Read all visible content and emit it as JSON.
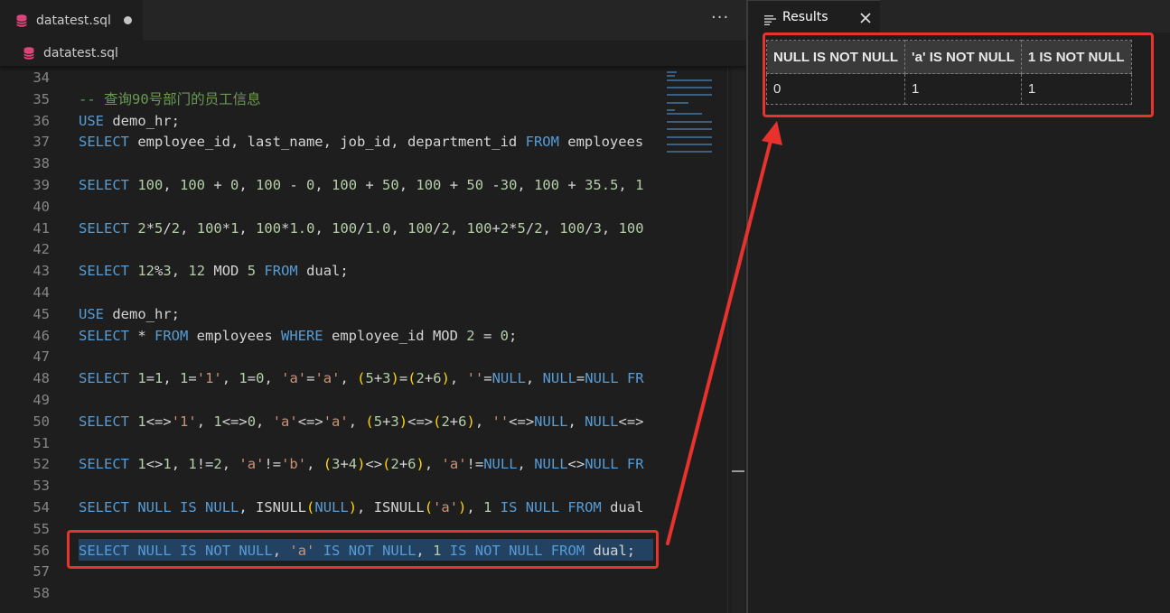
{
  "editor": {
    "tab_label": "datatest.sql",
    "breadcrumb_label": "datatest.sql",
    "more_actions_label": "···"
  },
  "code_lines": [
    {
      "num": "34",
      "tokens": []
    },
    {
      "num": "35",
      "tokens": [
        {
          "t": "-- 查询90号部门的员工信息",
          "c": "com"
        }
      ]
    },
    {
      "num": "36",
      "tokens": [
        {
          "t": "USE",
          "c": "kw"
        },
        {
          "t": " demo_hr;",
          "c": "id"
        }
      ]
    },
    {
      "num": "37",
      "tokens": [
        {
          "t": "SELECT",
          "c": "kw"
        },
        {
          "t": " employee_id, last_name, job_id, department_id ",
          "c": "id"
        },
        {
          "t": "FROM",
          "c": "kw"
        },
        {
          "t": " employees",
          "c": "id"
        }
      ]
    },
    {
      "num": "38",
      "tokens": []
    },
    {
      "num": "39",
      "tokens": [
        {
          "t": "SELECT",
          "c": "kw"
        },
        {
          "t": " ",
          "c": "id"
        },
        {
          "t": "100",
          "c": "num"
        },
        {
          "t": ", ",
          "c": "pun"
        },
        {
          "t": "100",
          "c": "num"
        },
        {
          "t": " + ",
          "c": "pun"
        },
        {
          "t": "0",
          "c": "num"
        },
        {
          "t": ", ",
          "c": "pun"
        },
        {
          "t": "100",
          "c": "num"
        },
        {
          "t": " - ",
          "c": "pun"
        },
        {
          "t": "0",
          "c": "num"
        },
        {
          "t": ", ",
          "c": "pun"
        },
        {
          "t": "100",
          "c": "num"
        },
        {
          "t": " + ",
          "c": "pun"
        },
        {
          "t": "50",
          "c": "num"
        },
        {
          "t": ", ",
          "c": "pun"
        },
        {
          "t": "100",
          "c": "num"
        },
        {
          "t": " + ",
          "c": "pun"
        },
        {
          "t": "50",
          "c": "num"
        },
        {
          "t": " -",
          "c": "pun"
        },
        {
          "t": "30",
          "c": "num"
        },
        {
          "t": ", ",
          "c": "pun"
        },
        {
          "t": "100",
          "c": "num"
        },
        {
          "t": " + ",
          "c": "pun"
        },
        {
          "t": "35.5",
          "c": "num"
        },
        {
          "t": ", ",
          "c": "pun"
        },
        {
          "t": "1",
          "c": "num"
        }
      ]
    },
    {
      "num": "40",
      "tokens": []
    },
    {
      "num": "41",
      "tokens": [
        {
          "t": "SELECT",
          "c": "kw"
        },
        {
          "t": " ",
          "c": "id"
        },
        {
          "t": "2",
          "c": "num"
        },
        {
          "t": "*",
          "c": "pun"
        },
        {
          "t": "5",
          "c": "num"
        },
        {
          "t": "/",
          "c": "pun"
        },
        {
          "t": "2",
          "c": "num"
        },
        {
          "t": ", ",
          "c": "pun"
        },
        {
          "t": "100",
          "c": "num"
        },
        {
          "t": "*",
          "c": "pun"
        },
        {
          "t": "1",
          "c": "num"
        },
        {
          "t": ", ",
          "c": "pun"
        },
        {
          "t": "100",
          "c": "num"
        },
        {
          "t": "*",
          "c": "pun"
        },
        {
          "t": "1.0",
          "c": "num"
        },
        {
          "t": ", ",
          "c": "pun"
        },
        {
          "t": "100",
          "c": "num"
        },
        {
          "t": "/",
          "c": "pun"
        },
        {
          "t": "1.0",
          "c": "num"
        },
        {
          "t": ", ",
          "c": "pun"
        },
        {
          "t": "100",
          "c": "num"
        },
        {
          "t": "/",
          "c": "pun"
        },
        {
          "t": "2",
          "c": "num"
        },
        {
          "t": ", ",
          "c": "pun"
        },
        {
          "t": "100",
          "c": "num"
        },
        {
          "t": "+",
          "c": "pun"
        },
        {
          "t": "2",
          "c": "num"
        },
        {
          "t": "*",
          "c": "pun"
        },
        {
          "t": "5",
          "c": "num"
        },
        {
          "t": "/",
          "c": "pun"
        },
        {
          "t": "2",
          "c": "num"
        },
        {
          "t": ", ",
          "c": "pun"
        },
        {
          "t": "100",
          "c": "num"
        },
        {
          "t": "/",
          "c": "pun"
        },
        {
          "t": "3",
          "c": "num"
        },
        {
          "t": ", ",
          "c": "pun"
        },
        {
          "t": "100",
          "c": "num"
        }
      ]
    },
    {
      "num": "42",
      "tokens": []
    },
    {
      "num": "43",
      "tokens": [
        {
          "t": "SELECT",
          "c": "kw"
        },
        {
          "t": " ",
          "c": "id"
        },
        {
          "t": "12",
          "c": "num"
        },
        {
          "t": "%",
          "c": "pun"
        },
        {
          "t": "3",
          "c": "num"
        },
        {
          "t": ", ",
          "c": "pun"
        },
        {
          "t": "12",
          "c": "num"
        },
        {
          "t": " MOD ",
          "c": "id"
        },
        {
          "t": "5",
          "c": "num"
        },
        {
          "t": " ",
          "c": "id"
        },
        {
          "t": "FROM",
          "c": "kw"
        },
        {
          "t": " dual;",
          "c": "id"
        }
      ]
    },
    {
      "num": "44",
      "tokens": []
    },
    {
      "num": "45",
      "tokens": [
        {
          "t": "USE",
          "c": "kw"
        },
        {
          "t": " demo_hr;",
          "c": "id"
        }
      ]
    },
    {
      "num": "46",
      "tokens": [
        {
          "t": "SELECT",
          "c": "kw"
        },
        {
          "t": " * ",
          "c": "id"
        },
        {
          "t": "FROM",
          "c": "kw"
        },
        {
          "t": " employees ",
          "c": "id"
        },
        {
          "t": "WHERE",
          "c": "kw"
        },
        {
          "t": " employee_id MOD ",
          "c": "id"
        },
        {
          "t": "2",
          "c": "num"
        },
        {
          "t": " = ",
          "c": "pun"
        },
        {
          "t": "0",
          "c": "num"
        },
        {
          "t": ";",
          "c": "pun"
        }
      ]
    },
    {
      "num": "47",
      "tokens": []
    },
    {
      "num": "48",
      "tokens": [
        {
          "t": "SELECT",
          "c": "kw"
        },
        {
          "t": " ",
          "c": "id"
        },
        {
          "t": "1",
          "c": "num"
        },
        {
          "t": "=",
          "c": "pun"
        },
        {
          "t": "1",
          "c": "num"
        },
        {
          "t": ", ",
          "c": "pun"
        },
        {
          "t": "1",
          "c": "num"
        },
        {
          "t": "=",
          "c": "pun"
        },
        {
          "t": "'1'",
          "c": "str"
        },
        {
          "t": ", ",
          "c": "pun"
        },
        {
          "t": "1",
          "c": "num"
        },
        {
          "t": "=",
          "c": "pun"
        },
        {
          "t": "0",
          "c": "num"
        },
        {
          "t": ", ",
          "c": "pun"
        },
        {
          "t": "'a'",
          "c": "str"
        },
        {
          "t": "=",
          "c": "pun"
        },
        {
          "t": "'a'",
          "c": "str"
        },
        {
          "t": ", ",
          "c": "pun"
        },
        {
          "t": "(",
          "c": "par"
        },
        {
          "t": "5",
          "c": "num"
        },
        {
          "t": "+",
          "c": "pun"
        },
        {
          "t": "3",
          "c": "num"
        },
        {
          "t": ")",
          "c": "par"
        },
        {
          "t": "=",
          "c": "pun"
        },
        {
          "t": "(",
          "c": "par"
        },
        {
          "t": "2",
          "c": "num"
        },
        {
          "t": "+",
          "c": "pun"
        },
        {
          "t": "6",
          "c": "num"
        },
        {
          "t": ")",
          "c": "par"
        },
        {
          "t": ", ",
          "c": "pun"
        },
        {
          "t": "''",
          "c": "str"
        },
        {
          "t": "=",
          "c": "pun"
        },
        {
          "t": "NULL",
          "c": "kw"
        },
        {
          "t": ", ",
          "c": "pun"
        },
        {
          "t": "NULL",
          "c": "kw"
        },
        {
          "t": "=",
          "c": "pun"
        },
        {
          "t": "NULL",
          "c": "kw"
        },
        {
          "t": " ",
          "c": "id"
        },
        {
          "t": "FR",
          "c": "kw"
        }
      ]
    },
    {
      "num": "49",
      "tokens": []
    },
    {
      "num": "50",
      "tokens": [
        {
          "t": "SELECT",
          "c": "kw"
        },
        {
          "t": " ",
          "c": "id"
        },
        {
          "t": "1",
          "c": "num"
        },
        {
          "t": "<=>",
          "c": "pun"
        },
        {
          "t": "'1'",
          "c": "str"
        },
        {
          "t": ", ",
          "c": "pun"
        },
        {
          "t": "1",
          "c": "num"
        },
        {
          "t": "<=>",
          "c": "pun"
        },
        {
          "t": "0",
          "c": "num"
        },
        {
          "t": ", ",
          "c": "pun"
        },
        {
          "t": "'a'",
          "c": "str"
        },
        {
          "t": "<=>",
          "c": "pun"
        },
        {
          "t": "'a'",
          "c": "str"
        },
        {
          "t": ", ",
          "c": "pun"
        },
        {
          "t": "(",
          "c": "par"
        },
        {
          "t": "5",
          "c": "num"
        },
        {
          "t": "+",
          "c": "pun"
        },
        {
          "t": "3",
          "c": "num"
        },
        {
          "t": ")",
          "c": "par"
        },
        {
          "t": "<=>",
          "c": "pun"
        },
        {
          "t": "(",
          "c": "par"
        },
        {
          "t": "2",
          "c": "num"
        },
        {
          "t": "+",
          "c": "pun"
        },
        {
          "t": "6",
          "c": "num"
        },
        {
          "t": ")",
          "c": "par"
        },
        {
          "t": ", ",
          "c": "pun"
        },
        {
          "t": "''",
          "c": "str"
        },
        {
          "t": "<=>",
          "c": "pun"
        },
        {
          "t": "NULL",
          "c": "kw"
        },
        {
          "t": ", ",
          "c": "pun"
        },
        {
          "t": "NULL",
          "c": "kw"
        },
        {
          "t": "<=>",
          "c": "pun"
        }
      ]
    },
    {
      "num": "51",
      "tokens": []
    },
    {
      "num": "52",
      "tokens": [
        {
          "t": "SELECT",
          "c": "kw"
        },
        {
          "t": " ",
          "c": "id"
        },
        {
          "t": "1",
          "c": "num"
        },
        {
          "t": "<>",
          "c": "pun"
        },
        {
          "t": "1",
          "c": "num"
        },
        {
          "t": ", ",
          "c": "pun"
        },
        {
          "t": "1",
          "c": "num"
        },
        {
          "t": "!=",
          "c": "pun"
        },
        {
          "t": "2",
          "c": "num"
        },
        {
          "t": ", ",
          "c": "pun"
        },
        {
          "t": "'a'",
          "c": "str"
        },
        {
          "t": "!=",
          "c": "pun"
        },
        {
          "t": "'b'",
          "c": "str"
        },
        {
          "t": ", ",
          "c": "pun"
        },
        {
          "t": "(",
          "c": "par"
        },
        {
          "t": "3",
          "c": "num"
        },
        {
          "t": "+",
          "c": "pun"
        },
        {
          "t": "4",
          "c": "num"
        },
        {
          "t": ")",
          "c": "par"
        },
        {
          "t": "<>",
          "c": "pun"
        },
        {
          "t": "(",
          "c": "par"
        },
        {
          "t": "2",
          "c": "num"
        },
        {
          "t": "+",
          "c": "pun"
        },
        {
          "t": "6",
          "c": "num"
        },
        {
          "t": ")",
          "c": "par"
        },
        {
          "t": ", ",
          "c": "pun"
        },
        {
          "t": "'a'",
          "c": "str"
        },
        {
          "t": "!=",
          "c": "pun"
        },
        {
          "t": "NULL",
          "c": "kw"
        },
        {
          "t": ", ",
          "c": "pun"
        },
        {
          "t": "NULL",
          "c": "kw"
        },
        {
          "t": "<>",
          "c": "pun"
        },
        {
          "t": "NULL",
          "c": "kw"
        },
        {
          "t": " ",
          "c": "id"
        },
        {
          "t": "FR",
          "c": "kw"
        }
      ]
    },
    {
      "num": "53",
      "tokens": []
    },
    {
      "num": "54",
      "tokens": [
        {
          "t": "SELECT",
          "c": "kw"
        },
        {
          "t": " ",
          "c": "id"
        },
        {
          "t": "NULL",
          "c": "kw"
        },
        {
          "t": " ",
          "c": "id"
        },
        {
          "t": "IS",
          "c": "kw"
        },
        {
          "t": " ",
          "c": "id"
        },
        {
          "t": "NULL",
          "c": "kw"
        },
        {
          "t": ", ISNULL",
          "c": "id"
        },
        {
          "t": "(",
          "c": "par"
        },
        {
          "t": "NULL",
          "c": "kw"
        },
        {
          "t": ")",
          "c": "par"
        },
        {
          "t": ", ISNULL",
          "c": "id"
        },
        {
          "t": "(",
          "c": "par"
        },
        {
          "t": "'a'",
          "c": "str"
        },
        {
          "t": ")",
          "c": "par"
        },
        {
          "t": ", ",
          "c": "pun"
        },
        {
          "t": "1",
          "c": "num"
        },
        {
          "t": " ",
          "c": "id"
        },
        {
          "t": "IS",
          "c": "kw"
        },
        {
          "t": " ",
          "c": "id"
        },
        {
          "t": "NULL",
          "c": "kw"
        },
        {
          "t": " ",
          "c": "id"
        },
        {
          "t": "FROM",
          "c": "kw"
        },
        {
          "t": " dual",
          "c": "id"
        }
      ]
    },
    {
      "num": "55",
      "tokens": []
    },
    {
      "num": "56",
      "tokens": [
        {
          "t": "SELECT",
          "c": "kw"
        },
        {
          "t": " ",
          "c": "id"
        },
        {
          "t": "NULL",
          "c": "kw"
        },
        {
          "t": " ",
          "c": "id"
        },
        {
          "t": "IS",
          "c": "kw"
        },
        {
          "t": " ",
          "c": "id"
        },
        {
          "t": "NOT",
          "c": "kw"
        },
        {
          "t": " ",
          "c": "id"
        },
        {
          "t": "NULL",
          "c": "kw"
        },
        {
          "t": ", ",
          "c": "pun"
        },
        {
          "t": "'a'",
          "c": "str"
        },
        {
          "t": " ",
          "c": "id"
        },
        {
          "t": "IS",
          "c": "kw"
        },
        {
          "t": " ",
          "c": "id"
        },
        {
          "t": "NOT",
          "c": "kw"
        },
        {
          "t": " ",
          "c": "id"
        },
        {
          "t": "NULL",
          "c": "kw"
        },
        {
          "t": ", ",
          "c": "pun"
        },
        {
          "t": "1",
          "c": "num"
        },
        {
          "t": " ",
          "c": "id"
        },
        {
          "t": "IS",
          "c": "kw"
        },
        {
          "t": " ",
          "c": "id"
        },
        {
          "t": "NOT",
          "c": "kw"
        },
        {
          "t": " ",
          "c": "id"
        },
        {
          "t": "NULL",
          "c": "kw"
        },
        {
          "t": " ",
          "c": "id"
        },
        {
          "t": "FROM",
          "c": "kw"
        },
        {
          "t": " dual;",
          "c": "id"
        }
      ]
    },
    {
      "num": "57",
      "tokens": []
    },
    {
      "num": "58",
      "tokens": []
    }
  ],
  "results": {
    "tab_label": "Results",
    "columns": [
      "NULL IS NOT NULL",
      "'a' IS NOT NULL",
      "1 IS NOT NULL"
    ],
    "rows": [
      [
        "0",
        "1",
        "1"
      ]
    ]
  },
  "colors": {
    "annotation": "#e8322d",
    "keyword": "#569cd6",
    "number": "#b5cea8",
    "string": "#ce9178",
    "comment": "#6a9955"
  }
}
